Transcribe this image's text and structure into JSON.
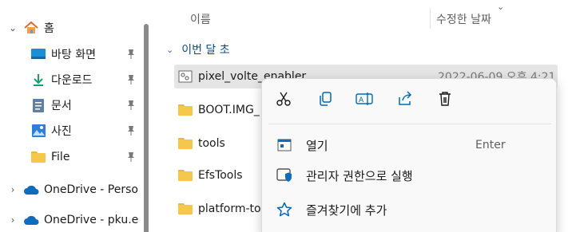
{
  "nav": {
    "items": [
      {
        "label": "홈",
        "icon": "home-icon",
        "expand": "chevron-down"
      },
      {
        "label": "바탕 화면",
        "icon": "desktop-icon",
        "pinned": true
      },
      {
        "label": "다운로드",
        "icon": "download-icon",
        "pinned": true
      },
      {
        "label": "문서",
        "icon": "document-icon",
        "pinned": true
      },
      {
        "label": "사진",
        "icon": "pictures-icon",
        "pinned": true
      },
      {
        "label": "File",
        "icon": "folder-icon",
        "pinned": true
      },
      {
        "label": "OneDrive - Perso",
        "icon": "onedrive-icon",
        "expand": "chevron-right"
      },
      {
        "label": "OneDrive - pku.e",
        "icon": "onedrive-icon",
        "expand": "chevron-right"
      }
    ]
  },
  "list": {
    "columns": {
      "name": "이름",
      "modified": "수정한 날짜"
    },
    "group": "이번 달 초",
    "files": [
      {
        "name": "pixel_volte_enabler",
        "date": "2022-06-09 오후 4:21",
        "icon": "file-icon",
        "selected": true
      },
      {
        "name": "BOOT.IMG_",
        "icon": "folder-icon"
      },
      {
        "name": "tools",
        "icon": "folder-icon"
      },
      {
        "name": "EfsTools",
        "icon": "folder-icon"
      },
      {
        "name": "platform-to",
        "icon": "folder-icon"
      }
    ]
  },
  "context_menu": {
    "quick_actions": [
      {
        "name": "cut",
        "icon": "scissors-icon"
      },
      {
        "name": "copy",
        "icon": "copy-icon"
      },
      {
        "name": "rename",
        "icon": "rename-icon"
      },
      {
        "name": "share",
        "icon": "share-icon"
      },
      {
        "name": "delete",
        "icon": "trash-icon"
      }
    ],
    "items": [
      {
        "label": "열기",
        "shortcut": "Enter",
        "icon": "open-icon"
      },
      {
        "label": "관리자 권한으로 실행",
        "icon": "admin-shield-icon"
      },
      {
        "label": "즐겨찾기에 추가",
        "icon": "star-icon"
      }
    ]
  },
  "colors": {
    "accent": "#0067c0",
    "folder": "#f5c84b",
    "selection": "#e5e5e5",
    "group_text": "#0f4c81"
  }
}
